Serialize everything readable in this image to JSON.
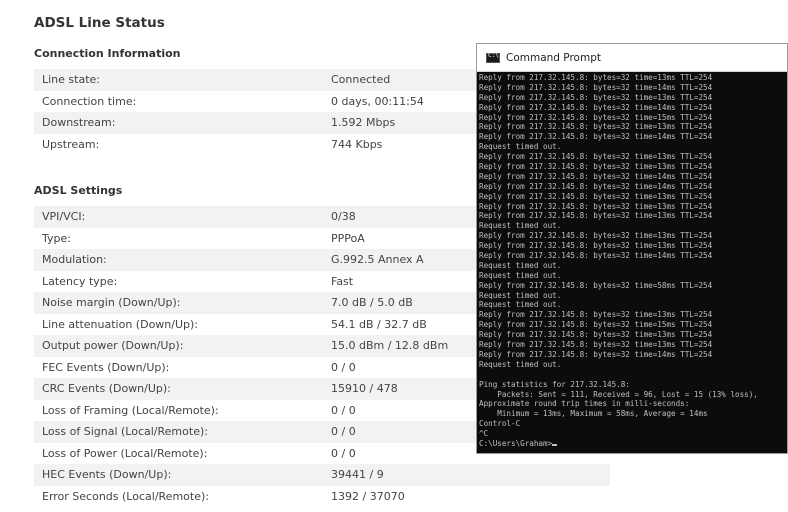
{
  "page": {
    "title": "ADSL Line Status"
  },
  "connection": {
    "title": "Connection Information",
    "rows": [
      {
        "label": "Line state:",
        "value": "Connected"
      },
      {
        "label": "Connection time:",
        "value": "0 days, 00:11:54"
      },
      {
        "label": "Downstream:",
        "value": "1.592 Mbps"
      },
      {
        "label": "Upstream:",
        "value": "744 Kbps"
      }
    ]
  },
  "adsl": {
    "title": "ADSL Settings",
    "rows": [
      {
        "label": "VPI/VCI:",
        "value": "0/38"
      },
      {
        "label": "Type:",
        "value": "PPPoA"
      },
      {
        "label": "Modulation:",
        "value": "G.992.5 Annex A"
      },
      {
        "label": "Latency type:",
        "value": "Fast"
      },
      {
        "label": "Noise margin (Down/Up):",
        "value": "7.0 dB / 5.0 dB"
      },
      {
        "label": "Line attenuation (Down/Up):",
        "value": "54.1 dB / 32.7 dB"
      },
      {
        "label": "Output power (Down/Up):",
        "value": "15.0 dBm / 12.8 dBm"
      },
      {
        "label": "FEC Events (Down/Up):",
        "value": "0 / 0"
      },
      {
        "label": "CRC Events (Down/Up):",
        "value": "15910 / 478"
      },
      {
        "label": "Loss of Framing (Local/Remote):",
        "value": "0 / 0"
      },
      {
        "label": "Loss of Signal (Local/Remote):",
        "value": "0 / 0"
      },
      {
        "label": "Loss of Power (Local/Remote):",
        "value": "0 / 0"
      },
      {
        "label": "HEC Events (Down/Up):",
        "value": "39441 / 9"
      },
      {
        "label": "Error Seconds (Local/Remote):",
        "value": "1392 / 37070"
      }
    ]
  },
  "cmd": {
    "title": "Command Prompt",
    "icon": "terminal-icon",
    "lines": [
      "Reply from 217.32.145.8: bytes=32 time=13ms TTL=254",
      "Reply from 217.32.145.8: bytes=32 time=14ms TTL=254",
      "Reply from 217.32.145.8: bytes=32 time=13ms TTL=254",
      "Reply from 217.32.145.8: bytes=32 time=14ms TTL=254",
      "Reply from 217.32.145.8: bytes=32 time=15ms TTL=254",
      "Reply from 217.32.145.8: bytes=32 time=13ms TTL=254",
      "Reply from 217.32.145.8: bytes=32 time=14ms TTL=254",
      "Request timed out.",
      "Reply from 217.32.145.8: bytes=32 time=13ms TTL=254",
      "Reply from 217.32.145.8: bytes=32 time=13ms TTL=254",
      "Reply from 217.32.145.8: bytes=32 time=14ms TTL=254",
      "Reply from 217.32.145.8: bytes=32 time=14ms TTL=254",
      "Reply from 217.32.145.8: bytes=32 time=13ms TTL=254",
      "Reply from 217.32.145.8: bytes=32 time=13ms TTL=254",
      "Reply from 217.32.145.8: bytes=32 time=13ms TTL=254",
      "Request timed out.",
      "Reply from 217.32.145.8: bytes=32 time=13ms TTL=254",
      "Reply from 217.32.145.8: bytes=32 time=13ms TTL=254",
      "Reply from 217.32.145.8: bytes=32 time=14ms TTL=254",
      "Request timed out.",
      "Request timed out.",
      "Reply from 217.32.145.8: bytes=32 time=58ms TTL=254",
      "Request timed out.",
      "Request timed out.",
      "Reply from 217.32.145.8: bytes=32 time=13ms TTL=254",
      "Reply from 217.32.145.8: bytes=32 time=15ms TTL=254",
      "Reply from 217.32.145.8: bytes=32 time=13ms TTL=254",
      "Reply from 217.32.145.8: bytes=32 time=13ms TTL=254",
      "Reply from 217.32.145.8: bytes=32 time=14ms TTL=254",
      "Request timed out.",
      "",
      "Ping statistics for 217.32.145.8:",
      "    Packets: Sent = 111, Received = 96, Lost = 15 (13% loss),",
      "Approximate round trip times in milli-seconds:",
      "    Minimum = 13ms, Maximum = 58ms, Average = 14ms",
      "Control-C",
      "^C",
      "C:\\Users\\Graham>"
    ]
  }
}
